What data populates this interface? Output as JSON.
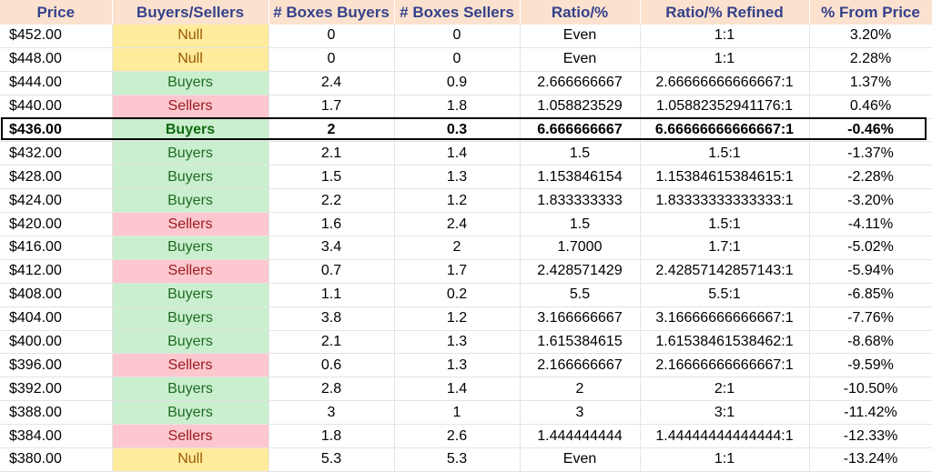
{
  "table": {
    "headers": [
      "Price",
      "Buyers/Sellers",
      "# Boxes Buyers",
      "# Boxes Sellers",
      "Ratio/%",
      "Ratio/% Refined",
      "% From Price"
    ],
    "rows": [
      [
        "$452.00",
        "Null",
        "0",
        "0",
        "Even",
        "1:1",
        "3.20%"
      ],
      [
        "$448.00",
        "Null",
        "0",
        "0",
        "Even",
        "1:1",
        "2.28%"
      ],
      [
        "$444.00",
        "Buyers",
        "2.4",
        "0.9",
        "2.666666667",
        "2.66666666666667:1",
        "1.37%"
      ],
      [
        "$440.00",
        "Sellers",
        "1.7",
        "1.8",
        "1.058823529",
        "1.05882352941176:1",
        "0.46%"
      ],
      [
        "$436.00",
        "Buyers",
        "2",
        "0.3",
        "6.666666667",
        "6.66666666666667:1",
        "-0.46%"
      ],
      [
        "$432.00",
        "Buyers",
        "2.1",
        "1.4",
        "1.5",
        "1.5:1",
        "-1.37%"
      ],
      [
        "$428.00",
        "Buyers",
        "1.5",
        "1.3",
        "1.153846154",
        "1.15384615384615:1",
        "-2.28%"
      ],
      [
        "$424.00",
        "Buyers",
        "2.2",
        "1.2",
        "1.833333333",
        "1.83333333333333:1",
        "-3.20%"
      ],
      [
        "$420.00",
        "Sellers",
        "1.6",
        "2.4",
        "1.5",
        "1.5:1",
        "-4.11%"
      ],
      [
        "$416.00",
        "Buyers",
        "3.4",
        "2",
        "1.7000",
        "1.7:1",
        "-5.02%"
      ],
      [
        "$412.00",
        "Sellers",
        "0.7",
        "1.7",
        "2.428571429",
        "2.42857142857143:1",
        "-5.94%"
      ],
      [
        "$408.00",
        "Buyers",
        "1.1",
        "0.2",
        "5.5",
        "5.5:1",
        "-6.85%"
      ],
      [
        "$404.00",
        "Buyers",
        "3.8",
        "1.2",
        "3.166666667",
        "3.16666666666667:1",
        "-7.76%"
      ],
      [
        "$400.00",
        "Buyers",
        "2.1",
        "1.3",
        "1.615384615",
        "1.61538461538462:1",
        "-8.68%"
      ],
      [
        "$396.00",
        "Sellers",
        "0.6",
        "1.3",
        "2.166666667",
        "2.16666666666667:1",
        "-9.59%"
      ],
      [
        "$392.00",
        "Buyers",
        "2.8",
        "1.4",
        "2",
        "2:1",
        "-10.50%"
      ],
      [
        "$388.00",
        "Buyers",
        "3",
        "1",
        "3",
        "3:1",
        "-11.42%"
      ],
      [
        "$384.00",
        "Sellers",
        "1.8",
        "2.6",
        "1.444444444",
        "1.44444444444444:1",
        "-12.33%"
      ],
      [
        "$380.00",
        "Null",
        "5.3",
        "5.3",
        "Even",
        "1:1",
        "-13.24%"
      ]
    ],
    "highlighted_row": 4,
    "colors": {
      "header_bg": "#fbe2cf",
      "header_text": "#35418a",
      "buyers_bg": "#c9efce",
      "buyers_text": "#1f6b23",
      "sellers_bg": "#fcc7ce",
      "sellers_text": "#9a1a1f",
      "null_bg": "#feeb9c",
      "null_text": "#9c5a00"
    }
  }
}
